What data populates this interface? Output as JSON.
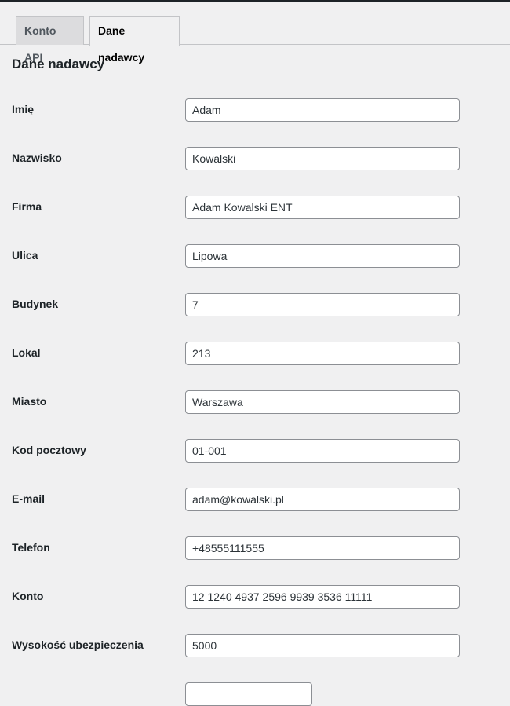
{
  "tabs": [
    {
      "label": "Konto API",
      "active": false
    },
    {
      "label": "Dane nadawcy",
      "active": true
    }
  ],
  "section": {
    "title": "Dane nadawcy"
  },
  "fields": [
    {
      "label": "Imię",
      "value": "Adam"
    },
    {
      "label": "Nazwisko",
      "value": "Kowalski"
    },
    {
      "label": "Firma",
      "value": "Adam Kowalski ENT"
    },
    {
      "label": "Ulica",
      "value": "Lipowa"
    },
    {
      "label": "Budynek",
      "value": "7"
    },
    {
      "label": "Lokal",
      "value": "213"
    },
    {
      "label": "Miasto",
      "value": "Warszawa"
    },
    {
      "label": "Kod pocztowy",
      "value": "01-001"
    },
    {
      "label": "E-mail",
      "value": "adam@kowalski.pl"
    },
    {
      "label": "Telefon",
      "value": "+48555111555"
    },
    {
      "label": "Konto",
      "value": "12 1240 4937 2596 9939 3536 11111"
    },
    {
      "label": "Wysokość ubezpieczenia",
      "value": "5000"
    }
  ],
  "partial_field": {
    "value": ""
  }
}
